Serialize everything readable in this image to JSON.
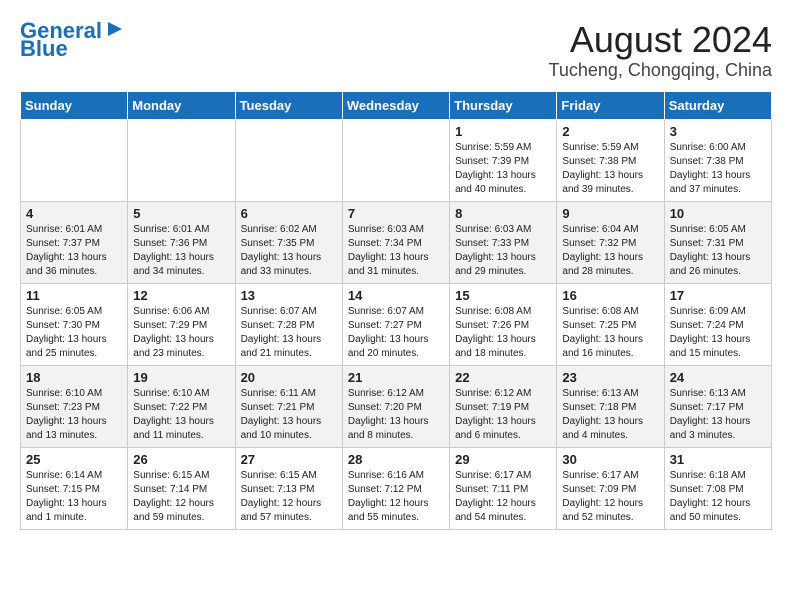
{
  "header": {
    "logo_line1": "General",
    "logo_line2": "Blue",
    "title": "August 2024",
    "subtitle": "Tucheng, Chongqing, China"
  },
  "days_of_week": [
    "Sunday",
    "Monday",
    "Tuesday",
    "Wednesday",
    "Thursday",
    "Friday",
    "Saturday"
  ],
  "weeks": [
    [
      {
        "day": "",
        "info": ""
      },
      {
        "day": "",
        "info": ""
      },
      {
        "day": "",
        "info": ""
      },
      {
        "day": "",
        "info": ""
      },
      {
        "day": "1",
        "info": "Sunrise: 5:59 AM\nSunset: 7:39 PM\nDaylight: 13 hours\nand 40 minutes."
      },
      {
        "day": "2",
        "info": "Sunrise: 5:59 AM\nSunset: 7:38 PM\nDaylight: 13 hours\nand 39 minutes."
      },
      {
        "day": "3",
        "info": "Sunrise: 6:00 AM\nSunset: 7:38 PM\nDaylight: 13 hours\nand 37 minutes."
      }
    ],
    [
      {
        "day": "4",
        "info": "Sunrise: 6:01 AM\nSunset: 7:37 PM\nDaylight: 13 hours\nand 36 minutes."
      },
      {
        "day": "5",
        "info": "Sunrise: 6:01 AM\nSunset: 7:36 PM\nDaylight: 13 hours\nand 34 minutes."
      },
      {
        "day": "6",
        "info": "Sunrise: 6:02 AM\nSunset: 7:35 PM\nDaylight: 13 hours\nand 33 minutes."
      },
      {
        "day": "7",
        "info": "Sunrise: 6:03 AM\nSunset: 7:34 PM\nDaylight: 13 hours\nand 31 minutes."
      },
      {
        "day": "8",
        "info": "Sunrise: 6:03 AM\nSunset: 7:33 PM\nDaylight: 13 hours\nand 29 minutes."
      },
      {
        "day": "9",
        "info": "Sunrise: 6:04 AM\nSunset: 7:32 PM\nDaylight: 13 hours\nand 28 minutes."
      },
      {
        "day": "10",
        "info": "Sunrise: 6:05 AM\nSunset: 7:31 PM\nDaylight: 13 hours\nand 26 minutes."
      }
    ],
    [
      {
        "day": "11",
        "info": "Sunrise: 6:05 AM\nSunset: 7:30 PM\nDaylight: 13 hours\nand 25 minutes."
      },
      {
        "day": "12",
        "info": "Sunrise: 6:06 AM\nSunset: 7:29 PM\nDaylight: 13 hours\nand 23 minutes."
      },
      {
        "day": "13",
        "info": "Sunrise: 6:07 AM\nSunset: 7:28 PM\nDaylight: 13 hours\nand 21 minutes."
      },
      {
        "day": "14",
        "info": "Sunrise: 6:07 AM\nSunset: 7:27 PM\nDaylight: 13 hours\nand 20 minutes."
      },
      {
        "day": "15",
        "info": "Sunrise: 6:08 AM\nSunset: 7:26 PM\nDaylight: 13 hours\nand 18 minutes."
      },
      {
        "day": "16",
        "info": "Sunrise: 6:08 AM\nSunset: 7:25 PM\nDaylight: 13 hours\nand 16 minutes."
      },
      {
        "day": "17",
        "info": "Sunrise: 6:09 AM\nSunset: 7:24 PM\nDaylight: 13 hours\nand 15 minutes."
      }
    ],
    [
      {
        "day": "18",
        "info": "Sunrise: 6:10 AM\nSunset: 7:23 PM\nDaylight: 13 hours\nand 13 minutes."
      },
      {
        "day": "19",
        "info": "Sunrise: 6:10 AM\nSunset: 7:22 PM\nDaylight: 13 hours\nand 11 minutes."
      },
      {
        "day": "20",
        "info": "Sunrise: 6:11 AM\nSunset: 7:21 PM\nDaylight: 13 hours\nand 10 minutes."
      },
      {
        "day": "21",
        "info": "Sunrise: 6:12 AM\nSunset: 7:20 PM\nDaylight: 13 hours\nand 8 minutes."
      },
      {
        "day": "22",
        "info": "Sunrise: 6:12 AM\nSunset: 7:19 PM\nDaylight: 13 hours\nand 6 minutes."
      },
      {
        "day": "23",
        "info": "Sunrise: 6:13 AM\nSunset: 7:18 PM\nDaylight: 13 hours\nand 4 minutes."
      },
      {
        "day": "24",
        "info": "Sunrise: 6:13 AM\nSunset: 7:17 PM\nDaylight: 13 hours\nand 3 minutes."
      }
    ],
    [
      {
        "day": "25",
        "info": "Sunrise: 6:14 AM\nSunset: 7:15 PM\nDaylight: 13 hours\nand 1 minute."
      },
      {
        "day": "26",
        "info": "Sunrise: 6:15 AM\nSunset: 7:14 PM\nDaylight: 12 hours\nand 59 minutes."
      },
      {
        "day": "27",
        "info": "Sunrise: 6:15 AM\nSunset: 7:13 PM\nDaylight: 12 hours\nand 57 minutes."
      },
      {
        "day": "28",
        "info": "Sunrise: 6:16 AM\nSunset: 7:12 PM\nDaylight: 12 hours\nand 55 minutes."
      },
      {
        "day": "29",
        "info": "Sunrise: 6:17 AM\nSunset: 7:11 PM\nDaylight: 12 hours\nand 54 minutes."
      },
      {
        "day": "30",
        "info": "Sunrise: 6:17 AM\nSunset: 7:09 PM\nDaylight: 12 hours\nand 52 minutes."
      },
      {
        "day": "31",
        "info": "Sunrise: 6:18 AM\nSunset: 7:08 PM\nDaylight: 12 hours\nand 50 minutes."
      }
    ]
  ]
}
